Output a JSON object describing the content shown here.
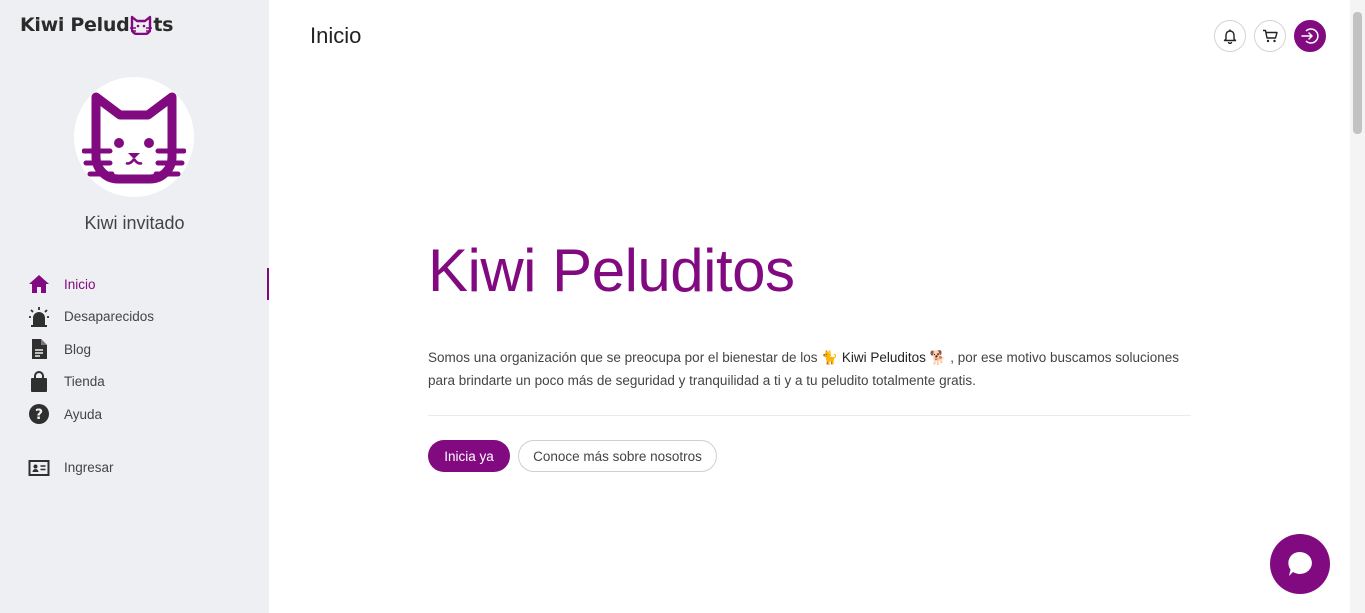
{
  "brand": {
    "logo_left": "Kiwi Pelud",
    "logo_right": "ts",
    "accent": "#820a80"
  },
  "user": {
    "name": "Kiwi invitado",
    "avatar_icon": "cat-face-icon"
  },
  "sidebar": {
    "items": [
      {
        "label": "Inicio",
        "icon": "home-icon",
        "active": true
      },
      {
        "label": "Desaparecidos",
        "icon": "alarm-light-icon"
      },
      {
        "label": "Blog",
        "icon": "document-icon"
      },
      {
        "label": "Tienda",
        "icon": "shopping-bag-icon"
      },
      {
        "label": "Ayuda",
        "icon": "help-circle-icon"
      }
    ],
    "login": {
      "label": "Ingresar",
      "icon": "id-card-icon"
    }
  },
  "header": {
    "title": "Inicio",
    "icons": [
      "bell-icon",
      "cart-icon",
      "logout-icon"
    ]
  },
  "hero": {
    "title": "Kiwi Peluditos",
    "text_before": "Somos una organización que se preocupa por el bienestar de los ",
    "cat_emoji": "🐈",
    "brand_name": " Kiwi Peluditos ",
    "dog_emoji": "🐕",
    "text_after": " , por ese motivo buscamos soluciones para brindarte un poco más de seguridad y tranquilidad a ti y a tu peludito totalmente gratis.",
    "primary_button": "Inicia ya",
    "secondary_button": "Conoce más sobre nosotros"
  },
  "chat": {
    "icon": "chat-bubble-icon"
  }
}
